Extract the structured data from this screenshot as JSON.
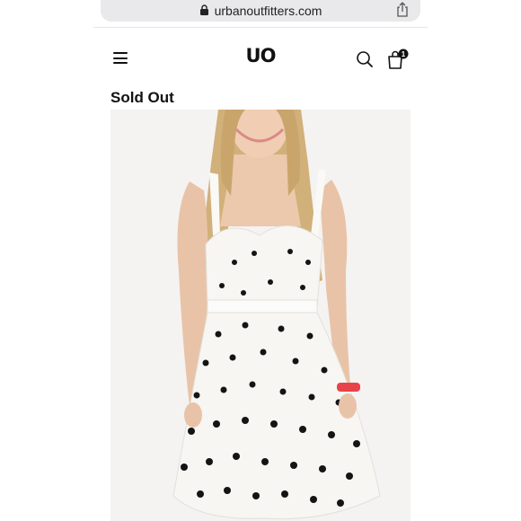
{
  "browser": {
    "url": "urbanoutfitters.com"
  },
  "header": {
    "logo": "UO",
    "cart_count": "1"
  },
  "product": {
    "status": "Sold Out",
    "image_description": "White sleeveless sweetheart dress with black polka dots",
    "dress_color": "#f7f6f3",
    "dot_color": "#141414",
    "bracelet_color": "#e8434a"
  }
}
